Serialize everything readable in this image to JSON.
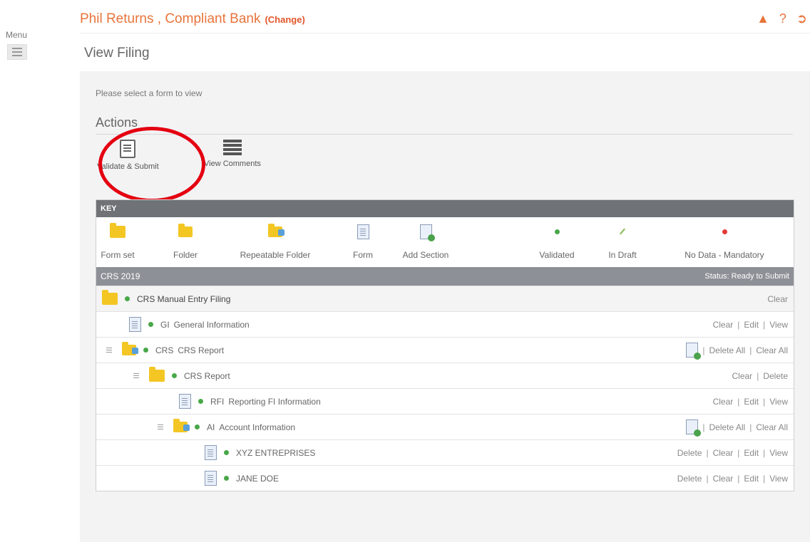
{
  "menu": {
    "label": "Menu"
  },
  "header": {
    "title": "Phil Returns , Compliant Bank",
    "change_label": "(Change)"
  },
  "page": {
    "title": "View Filing",
    "intro": "Please select a form to view"
  },
  "actions": {
    "heading": "Actions",
    "validate_label": "Validate & Submit",
    "comments_label": "View Comments"
  },
  "key": {
    "heading": "KEY",
    "items": [
      "Form set",
      "Folder",
      "Repeatable Folder",
      "Form",
      "Add Section",
      "Validated",
      "In Draft",
      "No Data - Mandatory"
    ]
  },
  "section": {
    "name": "CRS 2019",
    "status": "Status: Ready to Submit"
  },
  "rows": [
    {
      "code": "",
      "name": "CRS Manual Entry Filing",
      "actions": [
        "Clear"
      ]
    },
    {
      "code": "GI",
      "name": "General Information",
      "actions": [
        "Clear",
        "Edit",
        "View"
      ]
    },
    {
      "code": "CRS",
      "name": "CRS Report",
      "actions": [
        "Delete All",
        "Clear All"
      ]
    },
    {
      "code": "",
      "name": "CRS Report",
      "actions": [
        "Clear",
        "Delete"
      ]
    },
    {
      "code": "RFI",
      "name": "Reporting FI Information",
      "actions": [
        "Clear",
        "Edit",
        "View"
      ]
    },
    {
      "code": "AI",
      "name": "Account Information",
      "actions": [
        "Delete All",
        "Clear All"
      ]
    },
    {
      "code": "",
      "name": "XYZ ENTREPRISES",
      "actions": [
        "Delete",
        "Clear",
        "Edit",
        "View"
      ]
    },
    {
      "code": "",
      "name": "JANE DOE",
      "actions": [
        "Delete",
        "Clear",
        "Edit",
        "View"
      ]
    }
  ],
  "colors": {
    "accent": "#e8743b",
    "highlight_ring": "#e40010",
    "validated": "#48a748"
  }
}
